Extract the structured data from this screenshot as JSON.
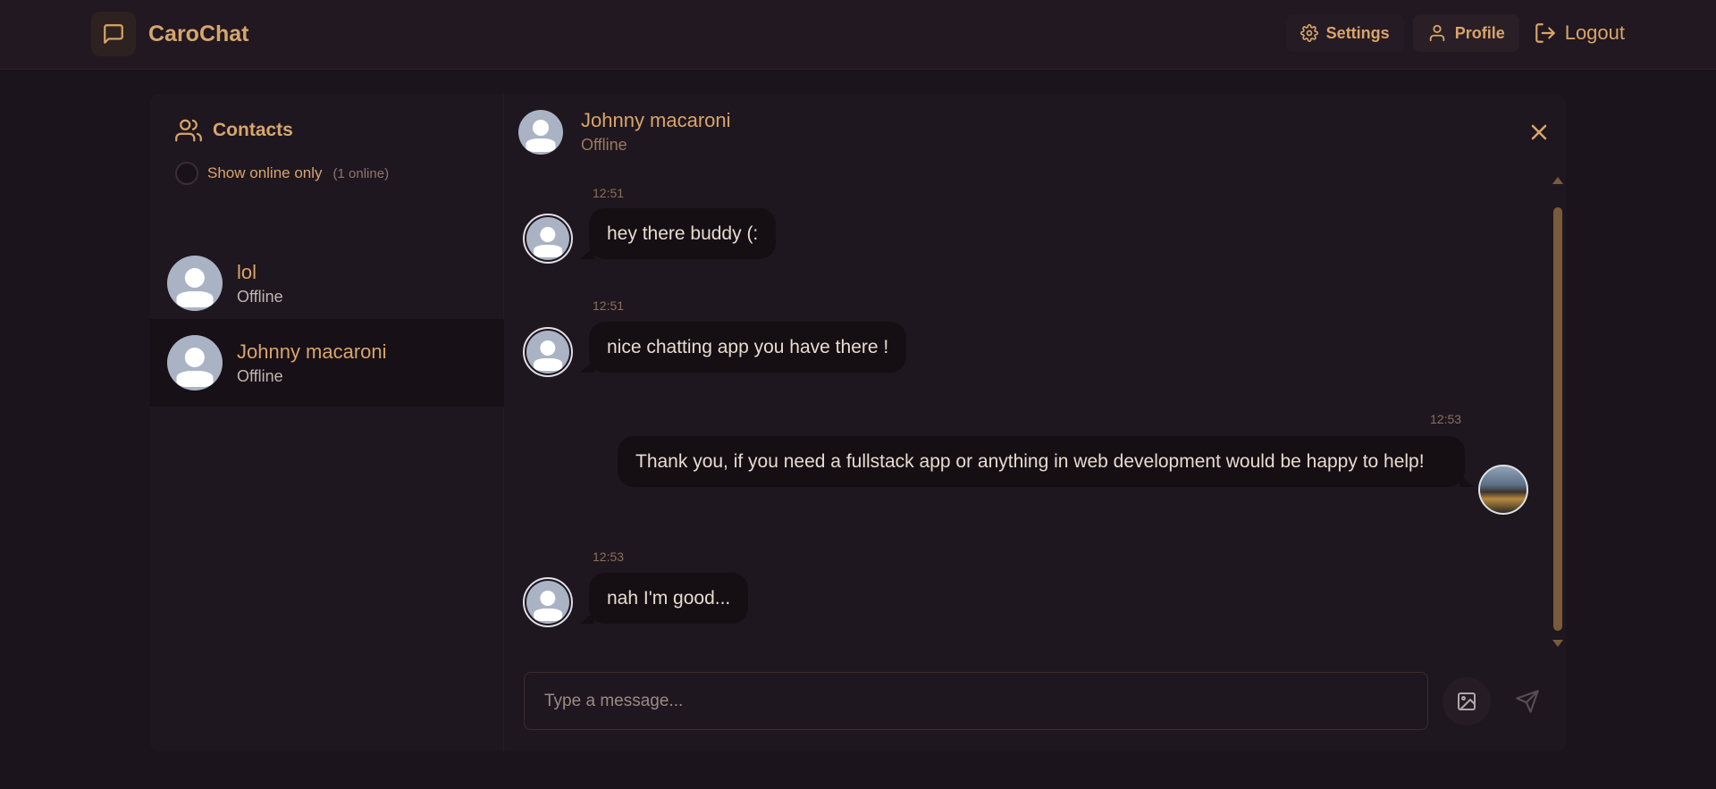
{
  "app": {
    "name": "CaroChat",
    "logo_icon": "message-square-icon"
  },
  "nav": {
    "settings_label": "Settings",
    "profile_label": "Profile",
    "logout_label": "Logout"
  },
  "sidebar": {
    "title": "Contacts",
    "online_toggle_label": "Show online only",
    "online_count": "(1 online)",
    "contacts": [
      {
        "name": "lol",
        "status": "Offline",
        "active": false
      },
      {
        "name": "Johnny macaroni",
        "status": "Offline",
        "active": true
      }
    ]
  },
  "chat": {
    "name": "Johnny macaroni",
    "status": "Offline",
    "messages": [
      {
        "time": "12:51",
        "text": "hey there buddy (:",
        "direction": "incoming"
      },
      {
        "time": "12:51",
        "text": "nice chatting app you have there !",
        "direction": "incoming"
      },
      {
        "time": "12:53",
        "text": "Thank you, if you need a fullstack app or anything in web development would be happy to help!",
        "direction": "outgoing"
      },
      {
        "time": "12:53",
        "text": "nah I'm good...",
        "direction": "incoming"
      }
    ]
  },
  "composer": {
    "placeholder": "Type a message..."
  },
  "colors": {
    "accent": "#d8a56a",
    "background": "#1c141c",
    "bubble": "#150f14"
  }
}
